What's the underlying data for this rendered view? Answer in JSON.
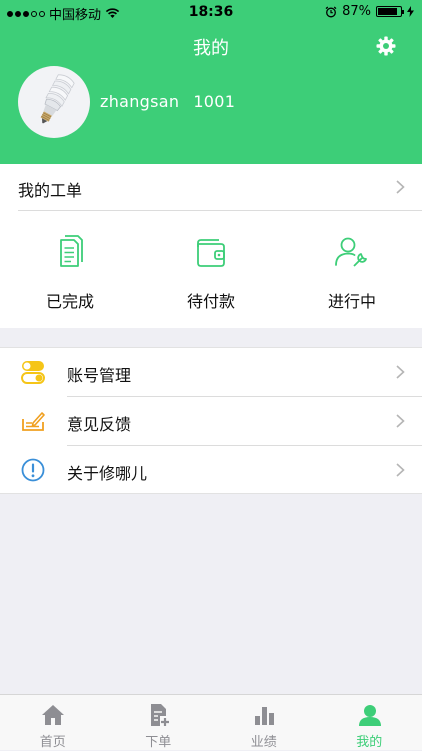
{
  "status_bar": {
    "carrier": "中国移动",
    "time": "18:36",
    "battery": "87%",
    "battery_level": 0.87
  },
  "header": {
    "title": "我的",
    "username": "zhangsan",
    "user_id": "1001",
    "background_color": "#3dce78"
  },
  "orders": {
    "title": "我的工单",
    "items": [
      {
        "label": "已完成",
        "icon": "document-icon"
      },
      {
        "label": "待付款",
        "icon": "wallet-icon"
      },
      {
        "label": "进行中",
        "icon": "user-wrench-icon"
      }
    ]
  },
  "menu": {
    "items": [
      {
        "label": "账号管理",
        "icon": "toggle-icon",
        "color": "#f5c518"
      },
      {
        "label": "意见反馈",
        "icon": "feedback-pen-icon",
        "color": "#f0a020"
      },
      {
        "label": "关于修哪儿",
        "icon": "info-icon",
        "color": "#3a8fd8"
      }
    ]
  },
  "tabbar": {
    "items": [
      {
        "label": "首页",
        "icon": "home-icon"
      },
      {
        "label": "下单",
        "icon": "order-add-icon"
      },
      {
        "label": "业绩",
        "icon": "bar-chart-icon"
      },
      {
        "label": "我的",
        "icon": "user-icon"
      }
    ],
    "active_index": 3,
    "active_color": "#3dce78",
    "inactive_color": "#8e8e93"
  }
}
